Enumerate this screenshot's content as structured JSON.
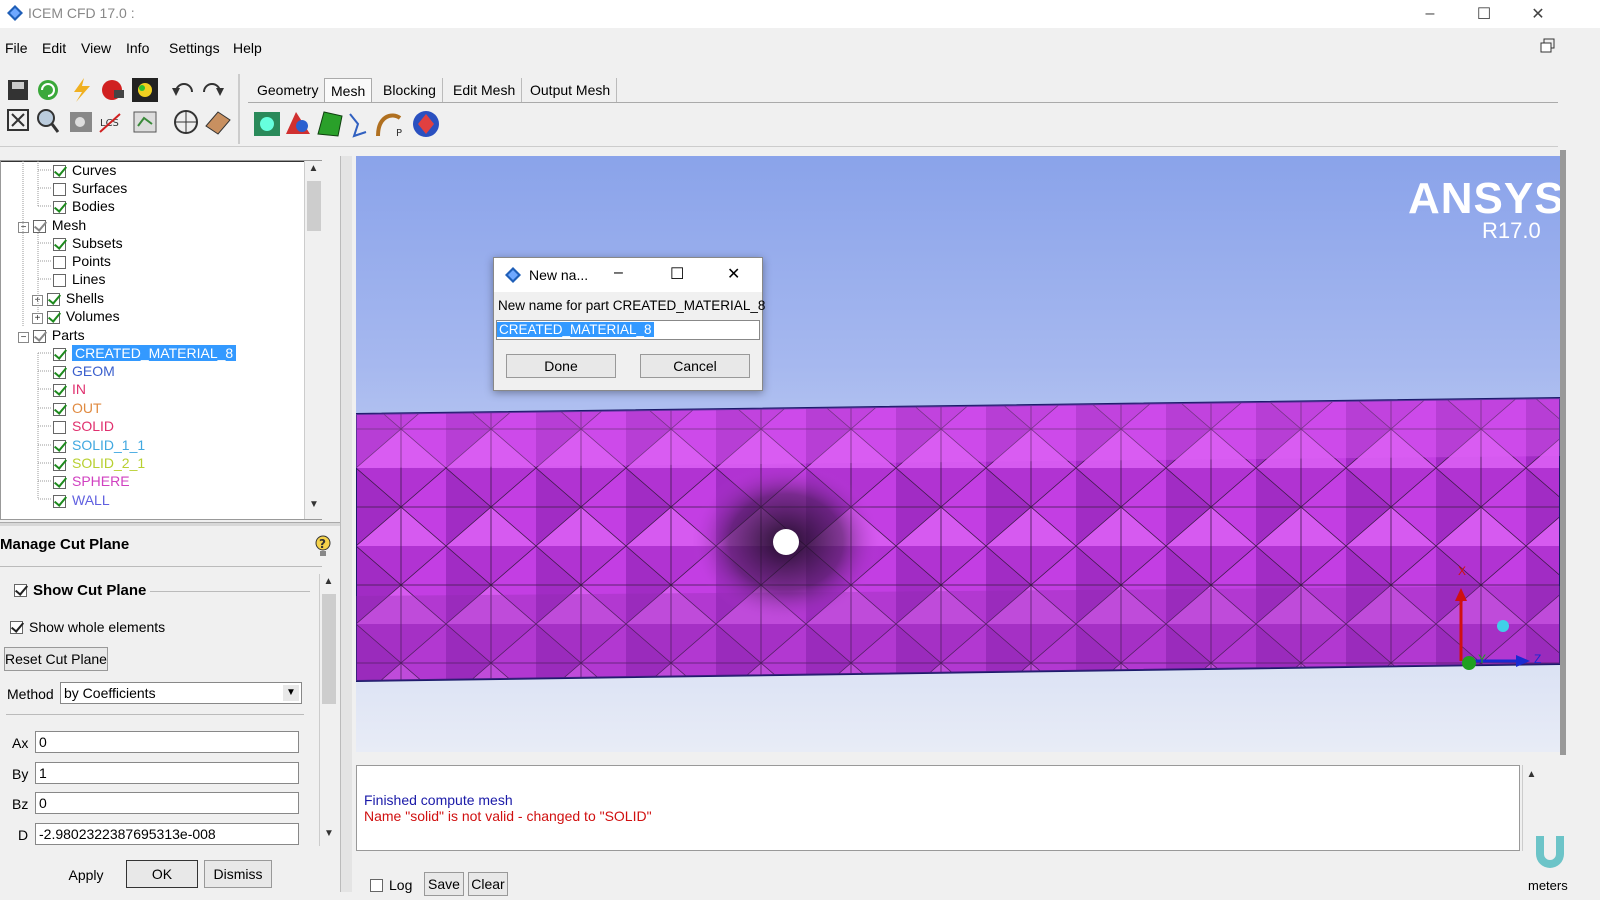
{
  "window": {
    "title": "ICEM CFD 17.0 :",
    "minimize": "–",
    "maximize": "☐",
    "close": "✕"
  },
  "menu": [
    "File",
    "Edit",
    "View",
    "Info",
    "Settings",
    "Help"
  ],
  "tabs": [
    "Geometry",
    "Mesh",
    "Blocking",
    "Edit Mesh",
    "Output Mesh"
  ],
  "active_tab": "Mesh",
  "tree": {
    "geometry_children": [
      {
        "label": "Curves",
        "checked": true
      },
      {
        "label": "Surfaces",
        "checked": false
      },
      {
        "label": "Bodies",
        "checked": true
      }
    ],
    "mesh": {
      "label": "Mesh"
    },
    "mesh_children": [
      {
        "label": "Subsets",
        "checked": true
      },
      {
        "label": "Points",
        "checked": false
      },
      {
        "label": "Lines",
        "checked": false
      },
      {
        "label": "Shells",
        "checked": true
      },
      {
        "label": "Volumes",
        "checked": true
      }
    ],
    "parts": {
      "label": "Parts"
    },
    "parts_children": [
      {
        "label": "CREATED_MATERIAL_8",
        "checked": true,
        "color": "#ffffff",
        "selected": true
      },
      {
        "label": "GEOM",
        "checked": true,
        "color": "#3a5fcd"
      },
      {
        "label": "IN",
        "checked": true,
        "color": "#e0306e"
      },
      {
        "label": "OUT",
        "checked": true,
        "color": "#e08a40"
      },
      {
        "label": "SOLID",
        "checked": false,
        "color": "#e0306e"
      },
      {
        "label": "SOLID_1_1",
        "checked": true,
        "color": "#40a8e0"
      },
      {
        "label": "SOLID_2_1",
        "checked": true,
        "color": "#b8d030"
      },
      {
        "label": "SPHERE",
        "checked": true,
        "color": "#d040c0"
      },
      {
        "label": "WALL",
        "checked": true,
        "color": "#6060e0"
      }
    ]
  },
  "cut_plane": {
    "title": "Manage Cut Plane",
    "show_cut_plane": "Show Cut Plane",
    "show_whole_elements": "Show whole elements",
    "reset": "Reset Cut Plane",
    "method_label": "Method",
    "method_value": "by Coefficients",
    "fields": [
      {
        "label": "Ax",
        "value": "0"
      },
      {
        "label": "By",
        "value": "1"
      },
      {
        "label": "Bz",
        "value": "0"
      },
      {
        "label": "D",
        "value": "-2.9802322387695313e-008"
      }
    ],
    "apply": "Apply",
    "ok": "OK",
    "dismiss": "Dismiss"
  },
  "viewport": {
    "brand": "ANSYS",
    "version": "R17.0",
    "axis_x": "X",
    "axis_y": "Y",
    "axis_z": "Z",
    "mesh_color": "#c33ee3",
    "units": "meters"
  },
  "dialog": {
    "title": "New na...",
    "prompt": "New name for part CREATED_MATERIAL_8",
    "input_value": "CREATED_MATERIAL_8",
    "done": "Done",
    "cancel": "Cancel"
  },
  "messages": [
    {
      "text": "Finished compute mesh",
      "color": "#1a1aa8"
    },
    {
      "text": "Name \"solid\" is not valid - changed to \"SOLID\"",
      "color": "#d01010"
    }
  ],
  "msgbar": {
    "log": "Log",
    "save": "Save",
    "clear": "Clear"
  }
}
